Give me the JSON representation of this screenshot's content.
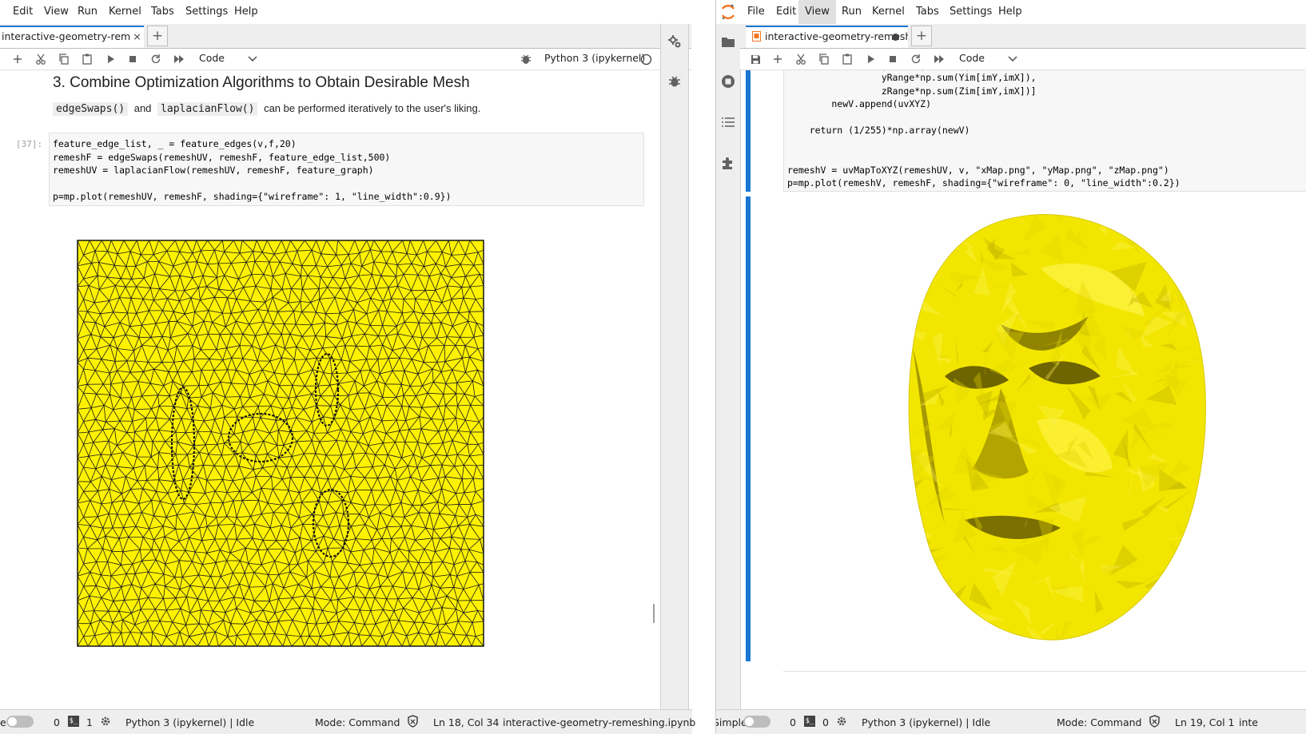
{
  "left": {
    "menu": [
      "Edit",
      "View",
      "Run",
      "Kernel",
      "Tabs",
      "Settings",
      "Help"
    ],
    "tab": {
      "title": "interactive-geometry-remesh",
      "close": "×"
    },
    "toolbar": {
      "cell_type": "Code",
      "kernel": "Python 3 (ipykernel)"
    },
    "heading": "3. Combine Optimization Algorithms to Obtain Desirable Mesh",
    "para": {
      "code1": "edgeSwaps()",
      "and": "and",
      "code2": "laplacianFlow()",
      "rest": "can be performed iteratively to the user's liking."
    },
    "prompt": "[37]:",
    "code_lines": [
      "feature_edge_list, _ = feature_edges(v,f,20)",
      "remeshF = edgeSwaps(remeshUV, remeshF, feature_edge_list,500)",
      "remeshUV = laplacianFlow(remeshUV, remeshF, feature_graph)",
      "",
      "p=mp.plot(remeshUV, remeshF, shading={\"wireframe\": 1, \"line_width\":0.9})"
    ],
    "status": {
      "e": "e",
      "terminals": "0",
      "kernels": "1",
      "kernel_status": "Python 3 (ipykernel) | Idle",
      "mode": "Mode: Command",
      "position": "Ln 18, Col 34",
      "file": "interactive-geometry-remeshing.ipynb"
    }
  },
  "right": {
    "menu": [
      "File",
      "Edit",
      "View",
      "Run",
      "Kernel",
      "Tabs",
      "Settings",
      "Help"
    ],
    "tab": {
      "title": "interactive-geometry-remesh"
    },
    "toolbar": {
      "cell_type": "Code"
    },
    "code_lines": [
      "                 yRange*np.sum(Yim[imY,imX]),",
      "                 zRange*np.sum(Zim[imY,imX])]",
      "        newV.append(uvXYZ)",
      "",
      "    return (1/255)*np.array(newV)",
      "",
      "",
      "remeshV = uvMapToXYZ(remeshUV, v, \"xMap.png\", \"yMap.png\", \"zMap.png\")",
      "p=mp.plot(remeshV, remeshF, shading={\"wireframe\": 0, \"line_width\":0.2})"
    ],
    "status": {
      "simple": "Simple",
      "terminals": "0",
      "kernels": "0",
      "kernel_status": "Python 3 (ipykernel) | Idle",
      "mode": "Mode: Command",
      "position": "Ln 19, Col 1",
      "file": "inte"
    }
  },
  "colors": {
    "mesh_fill": "#fff200",
    "face_fill": "#f2e600",
    "accent": "#1976d2",
    "logo": "#f37626"
  }
}
